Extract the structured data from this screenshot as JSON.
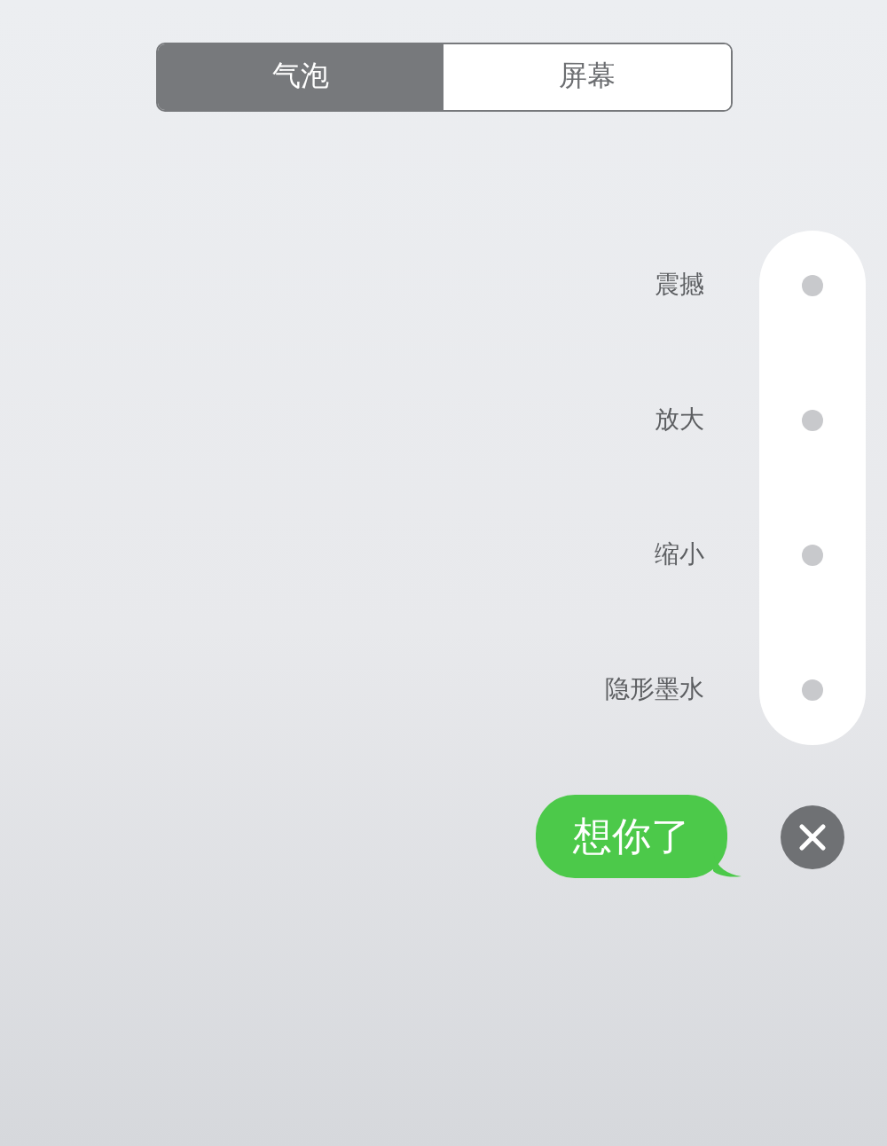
{
  "tabs": [
    {
      "label": "气泡",
      "selected": true
    },
    {
      "label": "屏幕",
      "selected": false
    }
  ],
  "effects": [
    {
      "label": "震撼",
      "selected": false
    },
    {
      "label": "放大",
      "selected": false
    },
    {
      "label": "缩小",
      "selected": false
    },
    {
      "label": "隐形墨水",
      "selected": false
    }
  ],
  "message": {
    "text": "想你了"
  }
}
